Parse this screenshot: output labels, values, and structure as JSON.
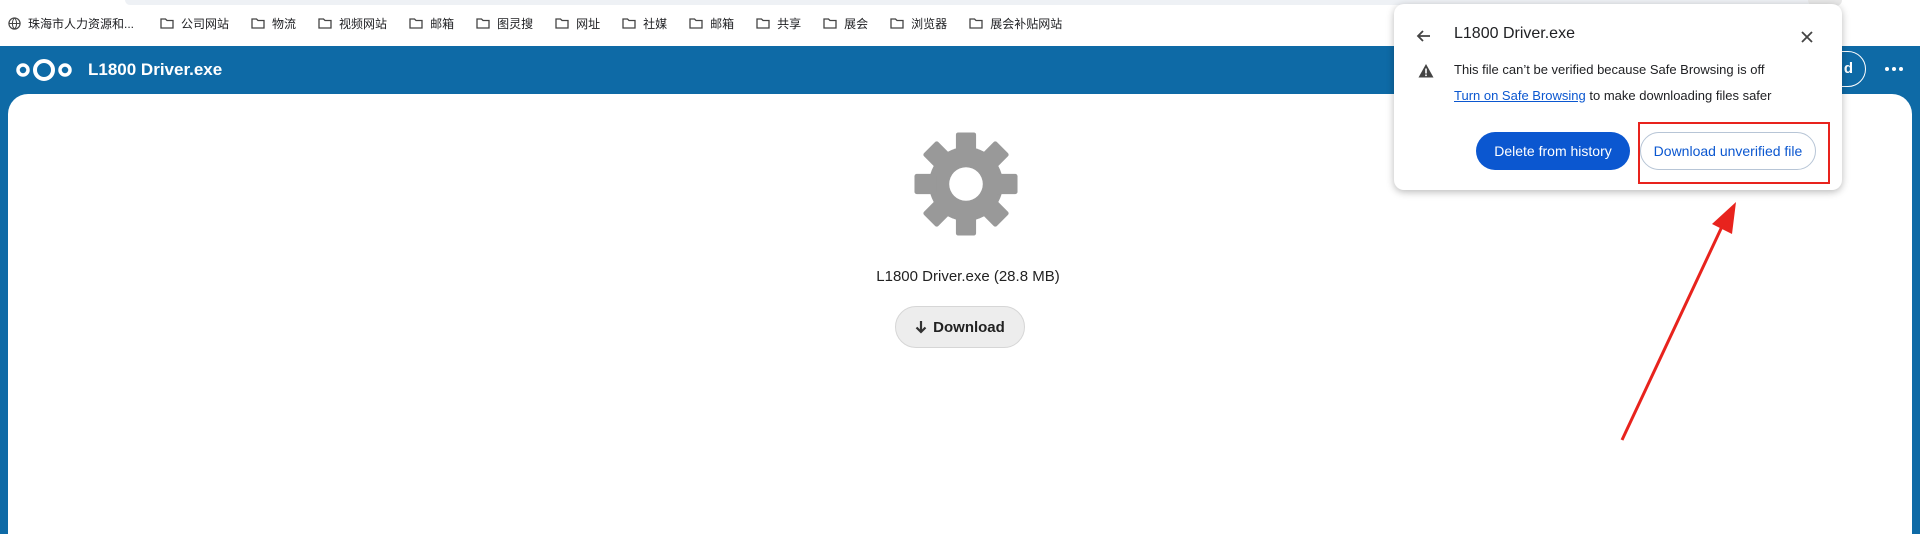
{
  "bookmarks": [
    {
      "label": "珠海市人力资源和...",
      "icon": "globe-icon"
    },
    {
      "label": "公司网站",
      "icon": "folder-icon"
    },
    {
      "label": "物流",
      "icon": "folder-icon"
    },
    {
      "label": "视频网站",
      "icon": "folder-icon"
    },
    {
      "label": "邮箱",
      "icon": "folder-icon"
    },
    {
      "label": "图灵搜",
      "icon": "folder-icon"
    },
    {
      "label": "网址",
      "icon": "folder-icon"
    },
    {
      "label": "社媒",
      "icon": "folder-icon"
    },
    {
      "label": "邮箱",
      "icon": "folder-icon"
    },
    {
      "label": "共享",
      "icon": "folder-icon"
    },
    {
      "label": "展会",
      "icon": "folder-icon"
    },
    {
      "label": "浏览器",
      "icon": "folder-icon"
    },
    {
      "label": "展会补贴网站",
      "icon": "folder-icon"
    }
  ],
  "header": {
    "title": "L1800 Driver.exe",
    "right_button_partial": "d"
  },
  "main": {
    "file_info": "L1800 Driver.exe (28.8 MB)",
    "download_label": "Download"
  },
  "bubble": {
    "title": "L1800 Driver.exe",
    "warning": "This file can’t be verified because Safe Browsing is off",
    "sb_link": "Turn on Safe Browsing",
    "sb_suffix": " to make downloading files safer",
    "delete_label": "Delete from history",
    "unverified_label": "Download unverified file"
  },
  "colors": {
    "brand": "#0e6aa6",
    "button_blue": "#0b57d0",
    "highlight": "#e8231d",
    "gear": "#999999"
  }
}
